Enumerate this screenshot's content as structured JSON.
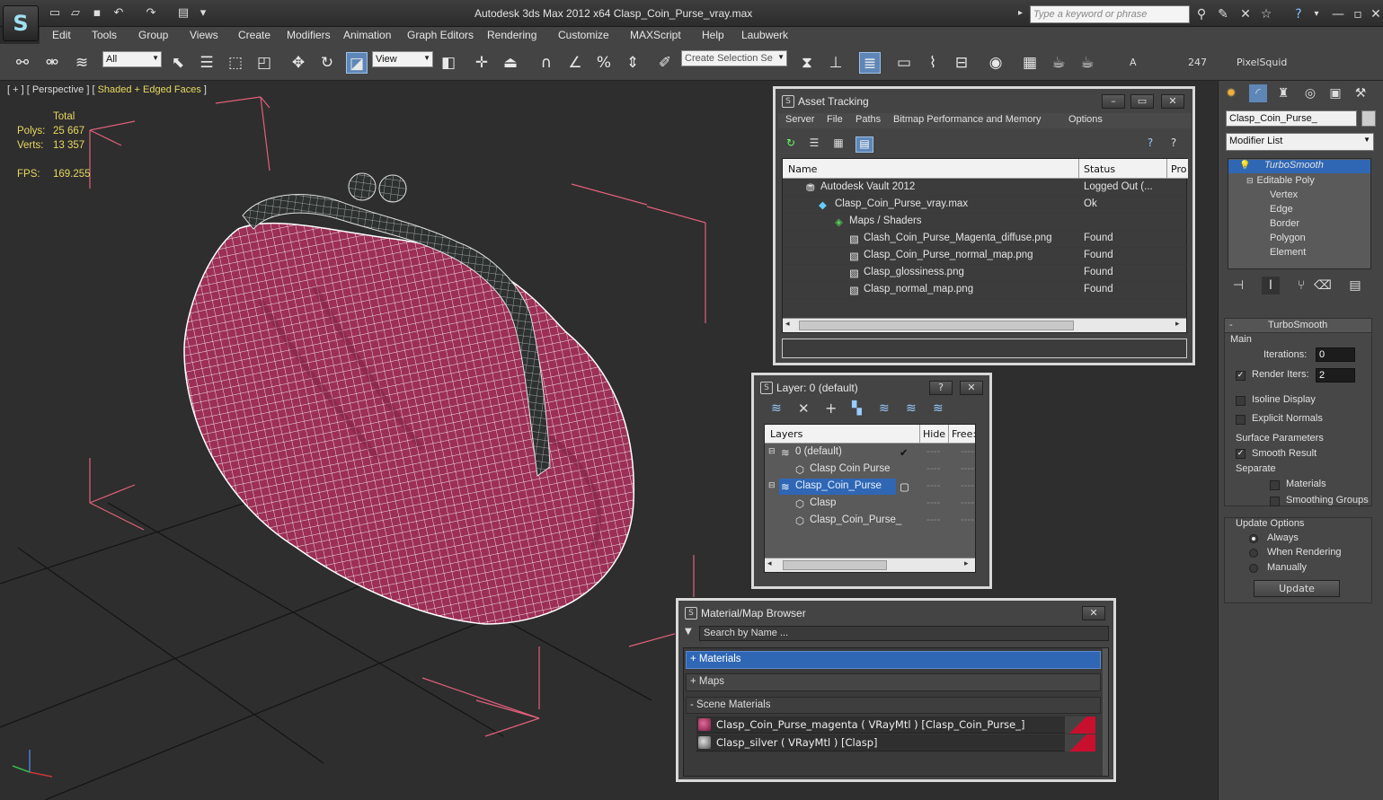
{
  "app": {
    "title": "Autodesk 3ds Max  2012 x64      Clasp_Coin_Purse_vray.max",
    "logo": "3ds-max-logo",
    "search_placeholder": "Type a keyword or phrase"
  },
  "menu": [
    "Edit",
    "Tools",
    "Group",
    "Views",
    "Create",
    "Modifiers",
    "Animation",
    "Graph Editors",
    "Rendering",
    "Customize",
    "MAXScript",
    "Help",
    "Laubwerk"
  ],
  "toolbar": {
    "filter_value": "All",
    "refcoord_value": "View",
    "selection_set_placeholder": "Create Selection Se",
    "plugin_letter": "A",
    "plugin_number": "247",
    "plugin_name": "PixelSquid"
  },
  "viewport": {
    "label_prefix": "[ + ] [ Perspective ] [ ",
    "label_mode": "Shaded + Edged Faces",
    "label_suffix": " ]",
    "stats_header": "Total",
    "polys_label": "Polys:",
    "polys_value": "25 667",
    "verts_label": "Verts:",
    "verts_value": "13 357",
    "fps_label": "FPS:",
    "fps_value": "169.255"
  },
  "command_panel": {
    "object_name": "Clasp_Coin_Purse_",
    "modifier_list": "Modifier List",
    "stack": [
      "TurboSmooth",
      "Editable Poly",
      "Vertex",
      "Edge",
      "Border",
      "Polygon",
      "Element"
    ],
    "rollout_title": "TurboSmooth",
    "main_label": "Main",
    "iterations_label": "Iterations:",
    "iterations_value": "0",
    "render_iters_label": "Render Iters:",
    "render_iters_value": "2",
    "isoline": "Isoline Display",
    "explicit_normals": "Explicit Normals",
    "surface_params": "Surface Parameters",
    "smooth_result": "Smooth Result",
    "separate": "Separate",
    "materials": "Materials",
    "smoothing_groups": "Smoothing Groups",
    "update_options": "Update Options",
    "always": "Always",
    "when_rendering": "When Rendering",
    "manually": "Manually",
    "update_button": "Update"
  },
  "asset_tracking": {
    "title": "Asset Tracking",
    "menu": [
      "Server",
      "File",
      "Paths",
      "Bitmap Performance and Memory",
      "Options"
    ],
    "col_name": "Name",
    "col_status": "Status",
    "col_pro": "Pro",
    "rows": [
      {
        "name": "Autodesk Vault 2012",
        "status": "Logged Out (..."
      },
      {
        "name": "Clasp_Coin_Purse_vray.max",
        "status": "Ok"
      },
      {
        "name": "Maps / Shaders",
        "status": ""
      },
      {
        "name": "Clash_Coin_Purse_Magenta_diffuse.png",
        "status": "Found"
      },
      {
        "name": "Clasp_Coin_Purse_normal_map.png",
        "status": "Found"
      },
      {
        "name": "Clasp_glossiness.png",
        "status": "Found"
      },
      {
        "name": "Clasp_normal_map.png",
        "status": "Found"
      }
    ]
  },
  "layer_window": {
    "title": "Layer: 0 (default)",
    "help": "?",
    "col_layers": "Layers",
    "col_hide": "Hide",
    "col_freeze": "Free:",
    "rows": [
      {
        "name": "0 (default)"
      },
      {
        "name": "Clasp Coin Purse"
      },
      {
        "name": "Clasp_Coin_Purse"
      },
      {
        "name": "Clasp"
      },
      {
        "name": "Clasp_Coin_Purse_"
      }
    ]
  },
  "material_browser": {
    "title": "Material/Map Browser",
    "search_placeholder": "Search by Name ...",
    "materials_group": "+ Materials",
    "maps_group": "+ Maps",
    "scene_group": "- Scene Materials",
    "items": [
      "Clasp_Coin_Purse_magenta ( VRayMtl ) [Clasp_Coin_Purse_]",
      "Clasp_silver ( VRayMtl ) [Clasp]"
    ]
  },
  "colors": {
    "purse_magenta": "#9c2f55",
    "wire_white": "#ffffff",
    "selection_blue": "#2f67b5",
    "stats_yellow": "#e8d860",
    "bbox_pink": "#e0607a"
  }
}
